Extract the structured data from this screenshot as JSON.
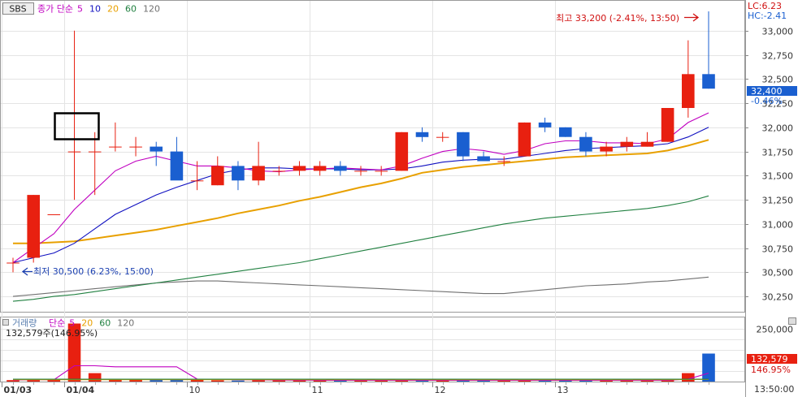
{
  "header": {
    "symbol": "SBS",
    "ma_label": "종가 단순",
    "ma_periods": [
      {
        "label": "5",
        "color": "#c000c0"
      },
      {
        "label": "10",
        "color": "#1010c0"
      },
      {
        "label": "20",
        "color": "#e8a000"
      },
      {
        "label": "60",
        "color": "#208040"
      },
      {
        "label": "120",
        "color": "#707070"
      }
    ]
  },
  "top_right": {
    "lc": "LC:6.23",
    "hc": "HC:-2.41"
  },
  "annotations": {
    "high": "최고 33,200 (-2.41%, 13:50)",
    "low": "최저 30,500 (6.23%, 15:00)"
  },
  "price_badge": {
    "value": "32,400",
    "change": "-0.46%"
  },
  "volume_header": {
    "label": "거래량",
    "ma_label": "단순",
    "ma_periods": [
      {
        "label": "5",
        "color": "#c000c0"
      },
      {
        "label": "20",
        "color": "#e8a000"
      },
      {
        "label": "60",
        "color": "#208040"
      },
      {
        "label": "120",
        "color": "#707070"
      }
    ],
    "current": "132,579주(146.95%)"
  },
  "volume_badge": {
    "value": "132,579",
    "change": "146.95%"
  },
  "time_axis": {
    "labels": [
      "01/03",
      "01/04",
      "10",
      "11",
      "12",
      "13"
    ],
    "right_label": "13:50:00"
  },
  "colors": {
    "up": "#e82010",
    "down": "#1a5fd0",
    "grid": "#e4e4e4",
    "axis_text": "#333333"
  },
  "chart_data": [
    {
      "type": "candlestick",
      "yticks": [
        30250,
        30500,
        30750,
        31000,
        31250,
        31500,
        31750,
        32000,
        32250,
        32500,
        32750,
        33000
      ],
      "ytick_labels": [
        "30,250",
        "30,500",
        "30,750",
        "31,000",
        "31,250",
        "31,500",
        "31,750",
        "32,000",
        "32,250",
        "32,500",
        "32,750",
        "33,000"
      ],
      "ylim": [
        30100,
        33250
      ],
      "candles": [
        {
          "o": 30600,
          "h": 30650,
          "l": 30500,
          "c": 30600
        },
        {
          "o": 30650,
          "h": 31300,
          "l": 30600,
          "c": 31300
        },
        {
          "o": 31100,
          "h": 31100,
          "l": 31100,
          "c": 31100
        },
        {
          "o": 31750,
          "h": 33000,
          "l": 31250,
          "c": 31750
        },
        {
          "o": 31750,
          "h": 31950,
          "l": 31300,
          "c": 31750
        },
        {
          "o": 31800,
          "h": 32050,
          "l": 31750,
          "c": 31800
        },
        {
          "o": 31800,
          "h": 31900,
          "l": 31700,
          "c": 31800
        },
        {
          "o": 31800,
          "h": 31850,
          "l": 31600,
          "c": 31750
        },
        {
          "o": 31750,
          "h": 31900,
          "l": 31500,
          "c": 31450
        },
        {
          "o": 31450,
          "h": 31650,
          "l": 31350,
          "c": 31450
        },
        {
          "o": 31400,
          "h": 31700,
          "l": 31400,
          "c": 31600
        },
        {
          "o": 31600,
          "h": 31650,
          "l": 31350,
          "c": 31450
        },
        {
          "o": 31450,
          "h": 31850,
          "l": 31400,
          "c": 31600
        },
        {
          "o": 31550,
          "h": 31600,
          "l": 31500,
          "c": 31550
        },
        {
          "o": 31550,
          "h": 31650,
          "l": 31500,
          "c": 31600
        },
        {
          "o": 31550,
          "h": 31650,
          "l": 31500,
          "c": 31600
        },
        {
          "o": 31600,
          "h": 31650,
          "l": 31500,
          "c": 31550
        },
        {
          "o": 31550,
          "h": 31600,
          "l": 31500,
          "c": 31550
        },
        {
          "o": 31550,
          "h": 31600,
          "l": 31500,
          "c": 31550
        },
        {
          "o": 31550,
          "h": 31950,
          "l": 31550,
          "c": 31950
        },
        {
          "o": 31950,
          "h": 32000,
          "l": 31850,
          "c": 31900
        },
        {
          "o": 31900,
          "h": 31950,
          "l": 31850,
          "c": 31900
        },
        {
          "o": 31950,
          "h": 31950,
          "l": 31650,
          "c": 31700
        },
        {
          "o": 31700,
          "h": 31750,
          "l": 31650,
          "c": 31650
        },
        {
          "o": 31650,
          "h": 31700,
          "l": 31600,
          "c": 31650
        },
        {
          "o": 31700,
          "h": 32050,
          "l": 31700,
          "c": 32050
        },
        {
          "o": 32050,
          "h": 32100,
          "l": 31950,
          "c": 32000
        },
        {
          "o": 32000,
          "h": 32000,
          "l": 31900,
          "c": 31900
        },
        {
          "o": 31900,
          "h": 31950,
          "l": 31700,
          "c": 31750
        },
        {
          "o": 31750,
          "h": 31850,
          "l": 31700,
          "c": 31800
        },
        {
          "o": 31800,
          "h": 31900,
          "l": 31750,
          "c": 31850
        },
        {
          "o": 31800,
          "h": 31950,
          "l": 31800,
          "c": 31850
        },
        {
          "o": 31850,
          "h": 32200,
          "l": 31850,
          "c": 32200
        },
        {
          "o": 32200,
          "h": 32900,
          "l": 32100,
          "c": 32550
        },
        {
          "o": 32550,
          "h": 33200,
          "l": 32400,
          "c": 32400
        }
      ],
      "ma": [
        {
          "name": "5",
          "color": "#c000c0",
          "values": [
            30600,
            30750,
            30900,
            31150,
            31350,
            31550,
            31650,
            31700,
            31650,
            31600,
            31600,
            31580,
            31550,
            31540,
            31560,
            31570,
            31580,
            31570,
            31560,
            31600,
            31680,
            31750,
            31780,
            31760,
            31720,
            31760,
            31830,
            31860,
            31860,
            31840,
            31840,
            31830,
            31880,
            32050,
            32150
          ]
        },
        {
          "name": "10",
          "color": "#1010c0",
          "values": [
            30600,
            30650,
            30700,
            30800,
            30950,
            31100,
            31200,
            31300,
            31380,
            31450,
            31520,
            31560,
            31580,
            31580,
            31570,
            31570,
            31570,
            31560,
            31560,
            31570,
            31600,
            31640,
            31660,
            31670,
            31670,
            31700,
            31730,
            31760,
            31780,
            31790,
            31800,
            31810,
            31830,
            31900,
            32000
          ]
        },
        {
          "name": "20",
          "color": "#e8a000",
          "values": [
            30800,
            30800,
            30810,
            30820,
            30850,
            30880,
            30910,
            30940,
            30980,
            31020,
            31060,
            31110,
            31150,
            31190,
            31240,
            31280,
            31330,
            31380,
            31420,
            31470,
            31530,
            31560,
            31590,
            31610,
            31630,
            31650,
            31670,
            31690,
            31700,
            31710,
            31720,
            31730,
            31760,
            31810,
            31870
          ]
        },
        {
          "name": "60",
          "color": "#208040",
          "values": [
            30200,
            30220,
            30250,
            30270,
            30300,
            30330,
            30360,
            30390,
            30420,
            30450,
            30480,
            30510,
            30540,
            30570,
            30600,
            30640,
            30680,
            30720,
            30760,
            30800,
            30840,
            30880,
            30920,
            30960,
            31000,
            31030,
            31060,
            31080,
            31100,
            31120,
            31140,
            31160,
            31190,
            31230,
            31290
          ]
        },
        {
          "name": "120",
          "color": "#707070",
          "values": [
            30250,
            30270,
            30290,
            30310,
            30330,
            30350,
            30370,
            30390,
            30400,
            30410,
            30410,
            30400,
            30390,
            30380,
            30370,
            30360,
            30350,
            30340,
            30330,
            30320,
            30310,
            30300,
            30290,
            30280,
            30280,
            30300,
            30320,
            30340,
            30360,
            30370,
            30380,
            30400,
            30410,
            30430,
            30450
          ]
        }
      ]
    },
    {
      "type": "bar",
      "yticks": [
        50000,
        100000,
        150000,
        200000,
        250000
      ],
      "ytick_labels": [
        "",
        "",
        "",
        "",
        "250,000"
      ],
      "ylim": [
        0,
        300000
      ],
      "values": [
        7000,
        12000,
        8000,
        275000,
        40000,
        10000,
        10000,
        10000,
        10000,
        12000,
        6000,
        5000,
        9000,
        6000,
        6000,
        6000,
        6000,
        5000,
        5000,
        8000,
        8000,
        6000,
        6000,
        6000,
        5000,
        9000,
        7000,
        6000,
        6000,
        6000,
        6000,
        6000,
        10000,
        40000,
        132579
      ],
      "ma": [
        {
          "name": "5",
          "color": "#c000c0",
          "values": [
            7000,
            9000,
            9000,
            75000,
            75000,
            70000,
            70000,
            70000,
            70000,
            12000,
            10000,
            9000,
            8000,
            7000,
            6500,
            6000,
            6000,
            6000,
            6000,
            6000,
            6000,
            6000,
            6000,
            6000,
            6000,
            6000,
            6000,
            6000,
            6000,
            6000,
            6000,
            6000,
            6000,
            12000,
            40000
          ]
        },
        {
          "name": "20",
          "color": "#e8a000",
          "values": [
            9000,
            9000,
            9000,
            9000,
            9000,
            9000,
            9000,
            9000,
            9000,
            9000,
            9000,
            9000,
            9000,
            9000,
            9000,
            9000,
            9000,
            9000,
            9000,
            9000,
            9000,
            9000,
            9000,
            9000,
            9000,
            9000,
            9000,
            9000,
            9000,
            9000,
            9000,
            9000,
            9000,
            9500,
            10500
          ]
        },
        {
          "name": "60",
          "color": "#208040",
          "values": [
            11000,
            11000,
            11000,
            11000,
            11000,
            11000,
            11000,
            11000,
            11000,
            11000,
            11000,
            11000,
            11000,
            11000,
            11000,
            11000,
            11000,
            11000,
            11000,
            11000,
            11000,
            11000,
            11000,
            11000,
            11000,
            11000,
            11000,
            11000,
            11000,
            11000,
            11000,
            11000,
            11000,
            11000,
            11500
          ]
        }
      ]
    }
  ]
}
